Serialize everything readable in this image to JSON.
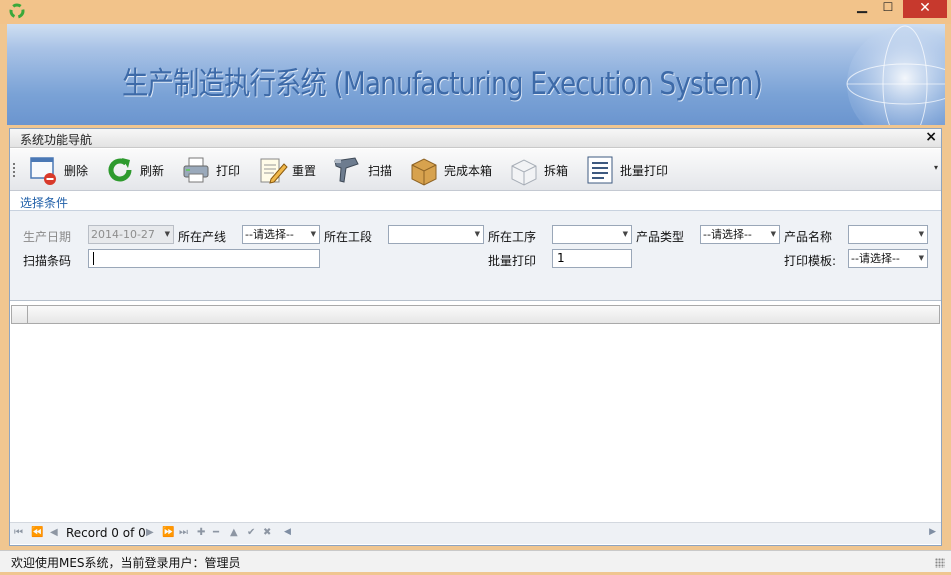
{
  "window": {
    "minimize_label": "▁",
    "maximize_label": "☐",
    "close_label": "✕"
  },
  "banner": {
    "title": "生产制造执行系统 (Manufacturing Execution System)"
  },
  "panel": {
    "title": "系统功能导航",
    "close_label": "×"
  },
  "toolbar": {
    "items": [
      {
        "label": "删除",
        "icon": "delete-icon"
      },
      {
        "label": "刷新",
        "icon": "refresh-icon"
      },
      {
        "label": "打印",
        "icon": "printer-icon"
      },
      {
        "label": "重置",
        "icon": "reset-icon"
      },
      {
        "label": "扫描",
        "icon": "barcode-scanner-icon"
      },
      {
        "label": "完成本箱",
        "icon": "box-icon"
      },
      {
        "label": "拆箱",
        "icon": "unbox-icon"
      },
      {
        "label": "批量打印",
        "icon": "batch-print-icon"
      }
    ],
    "overflow_label": "▾"
  },
  "filters": {
    "section_label": "选择条件",
    "production_date": {
      "label": "生产日期",
      "value": "2014-10-27"
    },
    "production_line": {
      "label": "所在产线",
      "value": "--请选择--"
    },
    "work_section": {
      "label": "所在工段",
      "value": ""
    },
    "process": {
      "label": "所在工序",
      "value": ""
    },
    "product_type": {
      "label": "产品类型",
      "value": "--请选择--"
    },
    "product_name": {
      "label": "产品名称",
      "value": ""
    },
    "scan_barcode": {
      "label": "扫描条码",
      "value": ""
    },
    "batch_print": {
      "label": "批量打印",
      "value": "1"
    },
    "print_template": {
      "label": "打印模板:",
      "value": "--请选择--"
    }
  },
  "navigator": {
    "record_text": "Record 0 of 0"
  },
  "status": {
    "text": "欢迎使用MES系统，当前登录用户：管理员"
  },
  "colors": {
    "title_bar": "#f2c38a",
    "close_button": "#c7392d",
    "banner_text": "#3d6aa8",
    "section_label": "#1f5fa8"
  }
}
